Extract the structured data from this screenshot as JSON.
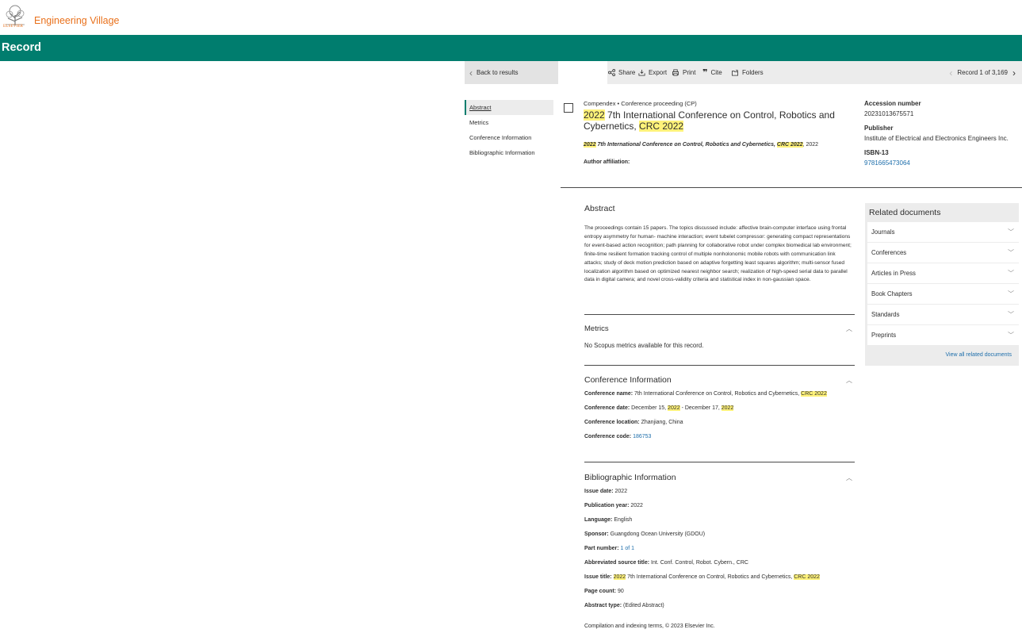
{
  "header": {
    "logo_text": "ELSEVIER",
    "brand": "Engineering Village"
  },
  "page_title": "Record",
  "toolbar": {
    "back": "Back to results",
    "share": "Share",
    "export": "Export",
    "print": "Print",
    "cite": "Cite",
    "folders": "Folders",
    "record_count": "Record 1 of 3,169"
  },
  "side_nav": [
    "Abstract",
    "Metrics",
    "Conference Information",
    "Bibliographic Information"
  ],
  "record": {
    "database": "Compendex",
    "doc_type": "Conference proceeding (CP)",
    "title_hl1": "2022",
    "title_mid": " 7th International Conference on Control, Robotics and Cybernetics, ",
    "title_hl2": "CRC 2022",
    "source_hl1": "2022",
    "source_mid": " 7th International Conference on Control, Robotics and Cybernetics, ",
    "source_hl2": "CRC 2022",
    "source_tail": ", 2022",
    "author_affiliation_label": "Author affiliation:"
  },
  "meta": {
    "accession_label": "Accession number",
    "accession_value": "20231013675571",
    "publisher_label": "Publisher",
    "publisher_value": "Institute of Electrical and Electronics Engineers Inc.",
    "isbn_label": "ISBN-13",
    "isbn_value": "9781665473064"
  },
  "abstract": {
    "heading": "Abstract",
    "text": "The proceedings contain 15 papers. The topics discussed include: affective brain-computer interface using frontal entropy asymmetry for human- machine interaction; event tubelet compressor: generating compact representations for event-based action recognition; path planning for collaborative robot under complex biomedical lab environment; finite-time resilient formation tracking control of multiple nonholonomic mobile robots with communication link attacks; study of deck motion prediction based on adaptive forgetting least squares algorithm; multi-sensor fused localization algorithm based on optimized nearest neighbor search; realization of high-speed serial data to parallel data in digital camera; and novel cross-validity criteria and statistical index in non-gaussian space."
  },
  "metrics": {
    "heading": "Metrics",
    "text": "No Scopus metrics available for this record."
  },
  "conference": {
    "heading": "Conference Information",
    "name_label": "Conference name:",
    "name_value": " 7th International Conference on Control, Robotics and Cybernetics, ",
    "name_hl": "CRC 2022",
    "date_label": "Conference date:",
    "date_a": " December 15, ",
    "date_hl1": "2022",
    "date_b": " - December 17, ",
    "date_hl2": "2022",
    "location_label": "Conference location:",
    "location_value": " Zhanjiang, China",
    "code_label": "Conference code:",
    "code_value": "186753"
  },
  "bibliographic": {
    "heading": "Bibliographic Information",
    "issue_date_label": "Issue date:",
    "issue_date_value": " 2022",
    "pub_year_label": "Publication year:",
    "pub_year_value": " 2022",
    "language_label": "Language:",
    "language_value": " English",
    "sponsor_label": "Sponsor:",
    "sponsor_value": " Guangdong Ocean University (GDOU)",
    "part_label": "Part number:",
    "part_value": "1 of 1",
    "abbrev_label": "Abbreviated source title:",
    "abbrev_value": " Int. Conf. Control, Robot. Cybern., CRC",
    "issue_title_label": "Issue title:",
    "issue_title_hl1": "2022",
    "issue_title_mid": " 7th International Conference on Control, Robotics and Cybernetics, ",
    "issue_title_hl2": "CRC 2022",
    "page_count_label": "Page count:",
    "page_count_value": " 90",
    "abstract_type_label": "Abstract type:",
    "abstract_type_value": " (Edited Abstract)",
    "copyright": "Compilation and indexing terms, © 2023 Elsevier Inc."
  },
  "related": {
    "heading": "Related documents",
    "items": [
      "Journals",
      "Conferences",
      "Articles in Press",
      "Book Chapters",
      "Standards",
      "Preprints"
    ],
    "view_all": "View all related documents"
  }
}
